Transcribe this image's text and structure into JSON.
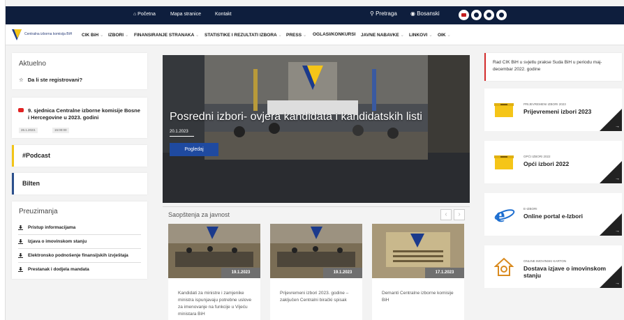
{
  "topbar": {
    "links": [
      {
        "label": "⌂ Početna"
      },
      {
        "label": "Mapa stranice"
      },
      {
        "label": "Kontakt"
      }
    ],
    "search_label": "Pretraga",
    "language": "Bosanski",
    "social_icons": [
      "youtube-icon",
      "instagram-icon",
      "twitter-icon",
      "flickr-icon"
    ]
  },
  "nav": {
    "logo_text": "Centralna izborna komisija BiH",
    "items": [
      {
        "label": "CIK BiH"
      },
      {
        "label": "IZBORI"
      },
      {
        "label": "FINANSIRANJE STRANAKA"
      },
      {
        "label": "STATISTIKE I REZULTATI IZBORA"
      },
      {
        "label": "PRESS"
      },
      {
        "label": "OGLASI/KONKURSI"
      },
      {
        "label": "JAVNE NABAVKE"
      },
      {
        "label": "LINKOVI"
      },
      {
        "label": "OIK"
      }
    ]
  },
  "aktuelno": {
    "title": "Aktuelno",
    "item": "Da li ste registrovani?"
  },
  "news": {
    "title": "9. sjednica Centralne izborne komisije Bosne i Hercegovine u 2023. godini",
    "date": "26.1.2023.",
    "time": "15:00:00"
  },
  "podcast": {
    "label": "#Podcast"
  },
  "bilten": {
    "label": "Bilten"
  },
  "preuzimanja": {
    "title": "Preuzimanja",
    "items": [
      {
        "label": "Pristup informacijama"
      },
      {
        "label": "Izjava o imovinskom stanju"
      },
      {
        "label": "Elektronsko podnošenje finansijskih izvještaja"
      },
      {
        "label": "Prestanak i dodjela mandata"
      }
    ]
  },
  "hero": {
    "title": "Posredni izbori- ovjera kandidata i kandidatskih listi",
    "date": "20.1.2023",
    "button": "Pogledaj"
  },
  "saopstenja": {
    "title": "Saopštenja za javnost",
    "cards": [
      {
        "date": "19.1.2023",
        "text": "Kandidati za ministre i zamjenike ministra ispunjavaju potrebne uslove za imenovanje na funkcije u Vijeću ministara BiH"
      },
      {
        "date": "19.1.2023",
        "text": "Prijevremeni izbori 2023. godine – zaključen Centralni birački spisak"
      },
      {
        "date": "17.1.2023",
        "text": "Demanti Centralne izborne komisije BiH"
      }
    ]
  },
  "right": {
    "top_text": "Rad CIK BiH u svjetlu prakse Suda BiH u periodu maj-decembar 2022. godine",
    "boxes": [
      {
        "small": "PRIJEVREMENI IZBORI 2023",
        "title": "Prijevremeni izbori 2023",
        "icon": "ballot-box-icon"
      },
      {
        "small": "OPĆI IZBORI 2022",
        "title": "Opći izbori 2022",
        "icon": "ballot-box-icon"
      },
      {
        "small": "E-IZBORI",
        "title": "Online portal e-Izbori",
        "icon": "browser-icon"
      },
      {
        "small": "ONLINE IMOVINSKI KARTON",
        "title": "Dostava izjave o imovinskom stanju",
        "icon": "house-icon"
      }
    ]
  },
  "colors": {
    "navy": "#0e1e3d",
    "accent_blue": "#1f4aa0",
    "podcast_yellow": "#f2c417",
    "red": "#d42c2c"
  }
}
